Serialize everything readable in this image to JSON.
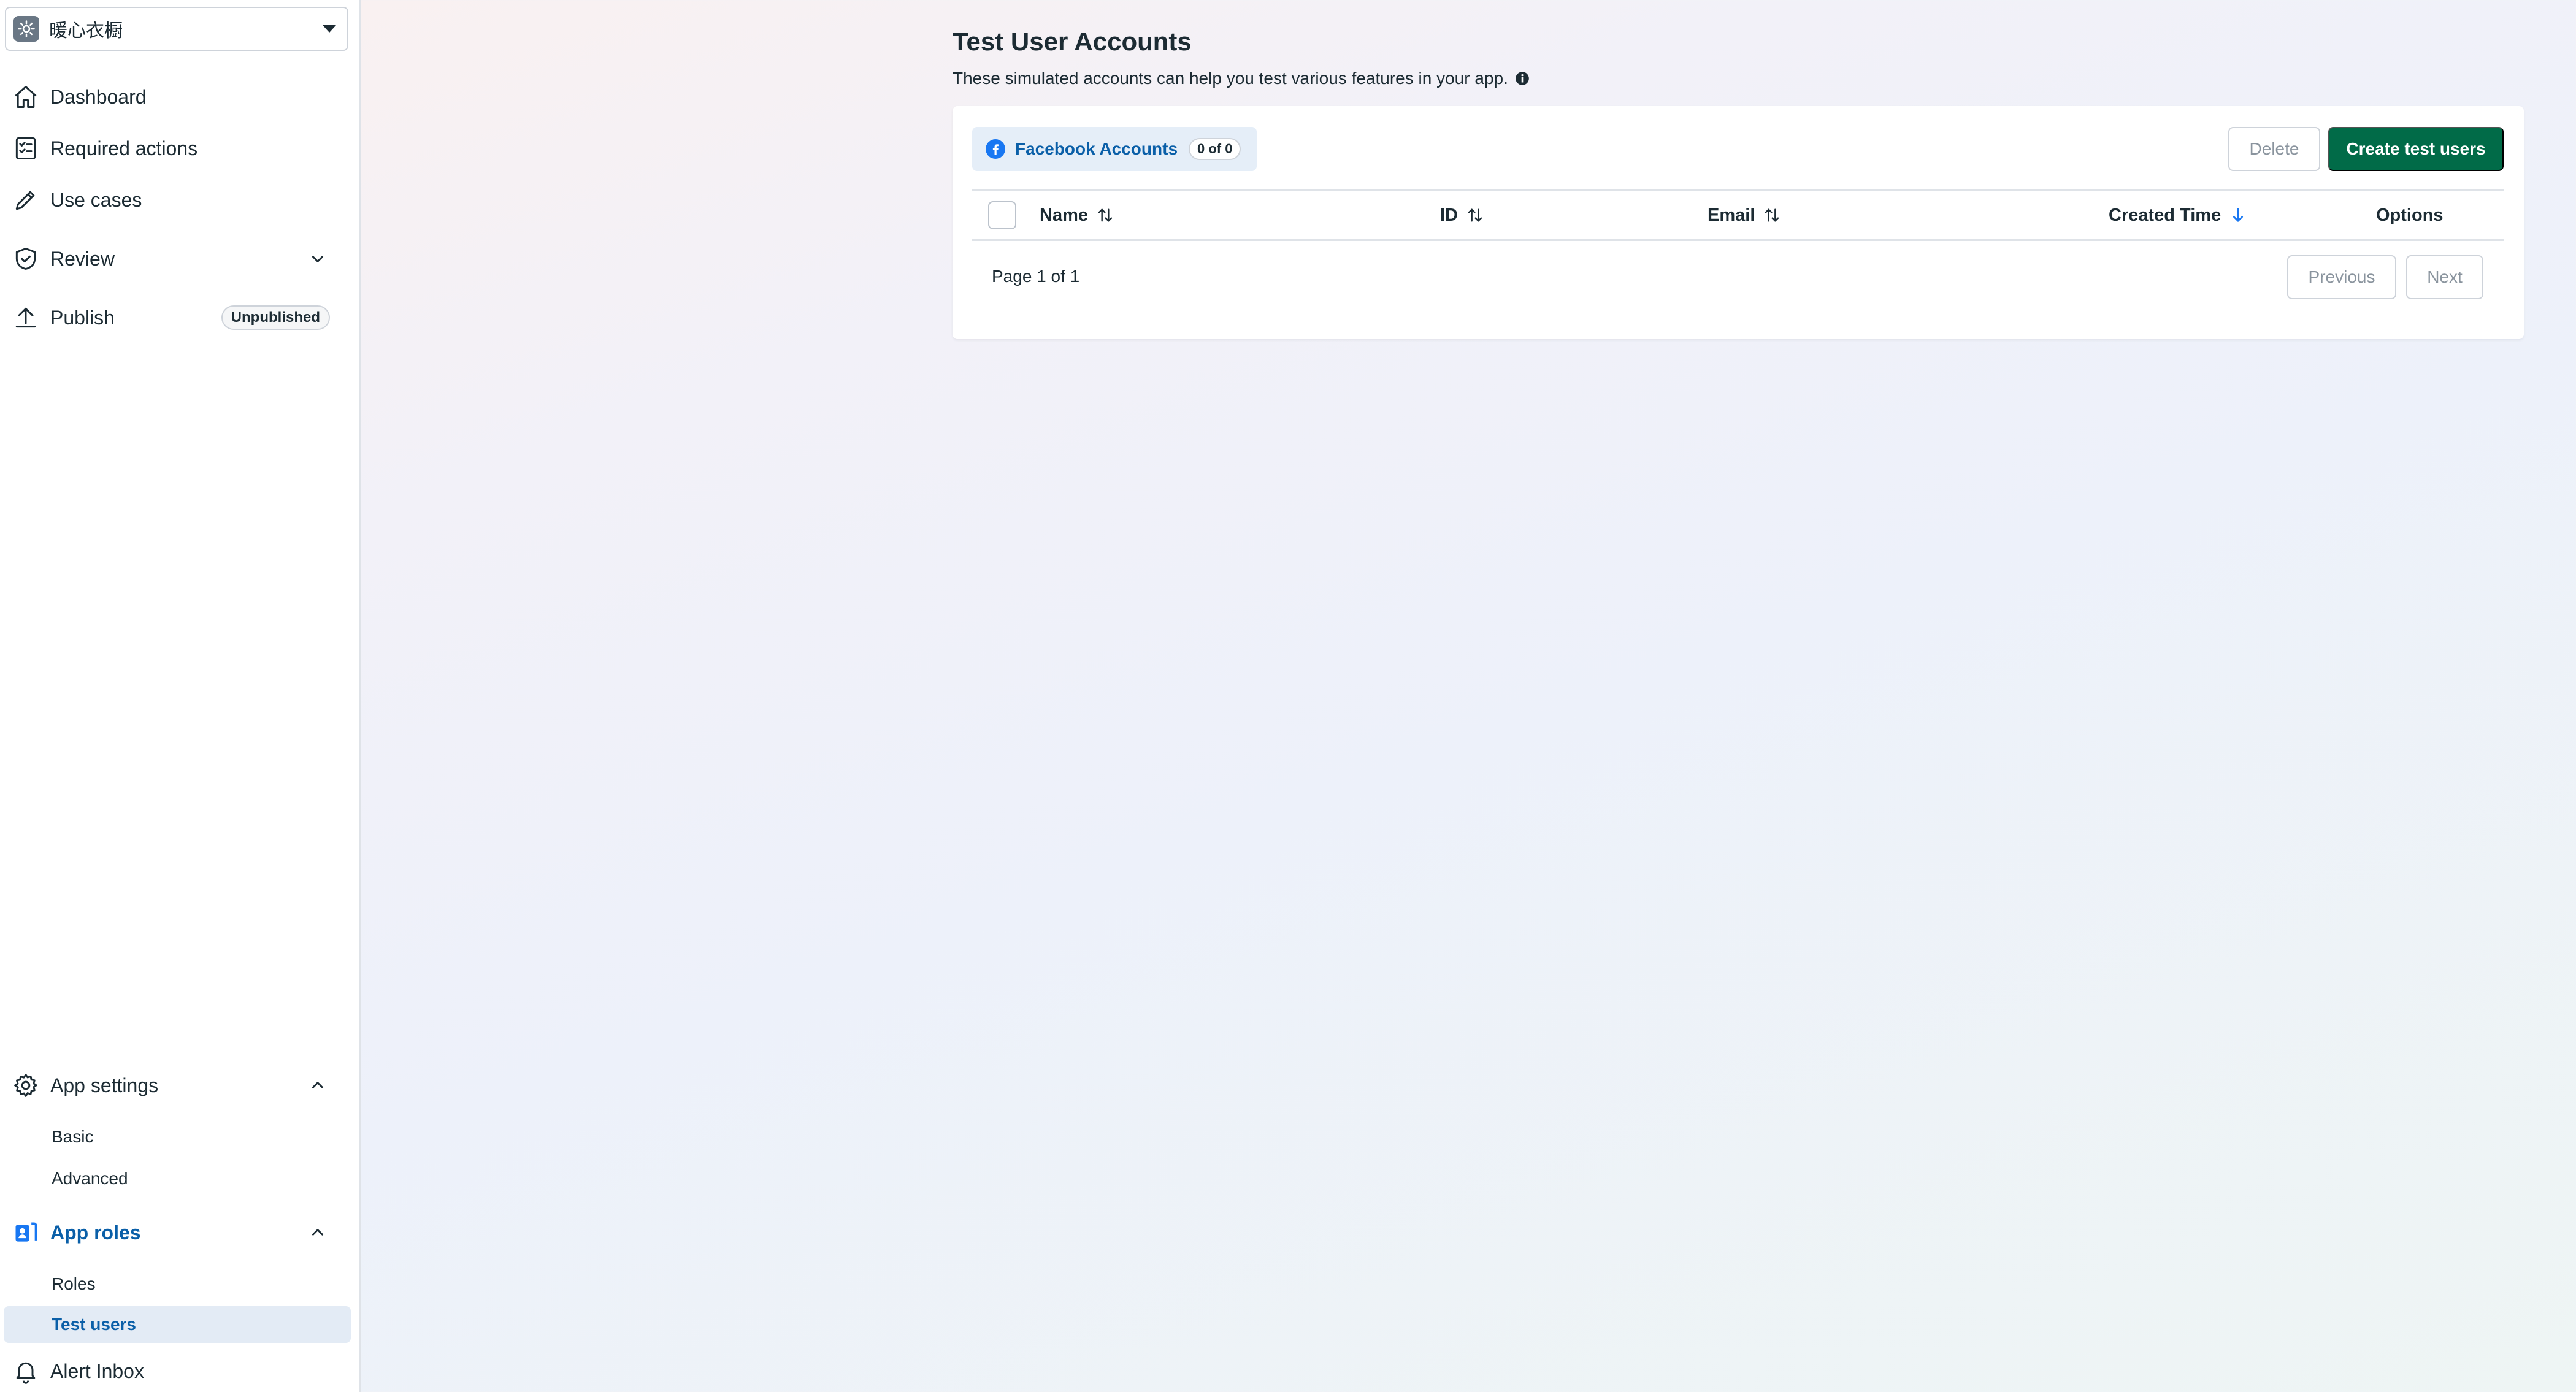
{
  "app_switcher": {
    "app_name": "暖心衣橱"
  },
  "sidebar": {
    "items": [
      {
        "label": "Dashboard"
      },
      {
        "label": "Required actions"
      },
      {
        "label": "Use cases"
      },
      {
        "label": "Review"
      },
      {
        "label": "Publish",
        "badge": "Unpublished"
      }
    ],
    "app_settings": {
      "label": "App settings",
      "children": [
        {
          "label": "Basic"
        },
        {
          "label": "Advanced"
        }
      ]
    },
    "app_roles": {
      "label": "App roles",
      "children": [
        {
          "label": "Roles"
        },
        {
          "label": "Test users"
        }
      ]
    },
    "alert_inbox": {
      "label": "Alert Inbox"
    }
  },
  "main": {
    "title": "Test User Accounts",
    "description": "These simulated accounts can help you test various features in your app.",
    "tab": {
      "label": "Facebook Accounts",
      "count": "0 of 0"
    },
    "actions": {
      "delete_label": "Delete",
      "create_label": "Create test users"
    },
    "table": {
      "columns": [
        {
          "label": "Name",
          "sort": "unsorted"
        },
        {
          "label": "ID",
          "sort": "unsorted"
        },
        {
          "label": "Email",
          "sort": "unsorted"
        },
        {
          "label": "Created Time",
          "sort": "descending"
        },
        {
          "label": "Options"
        }
      ]
    },
    "pagination": {
      "info": "Page 1 of 1",
      "previous_label": "Previous",
      "next_label": "Next"
    }
  },
  "colors": {
    "primary_button": "#016b48",
    "active_link": "#0a5fa8",
    "facebook_blue": "#1877f2",
    "sort_active": "#1877f2"
  }
}
